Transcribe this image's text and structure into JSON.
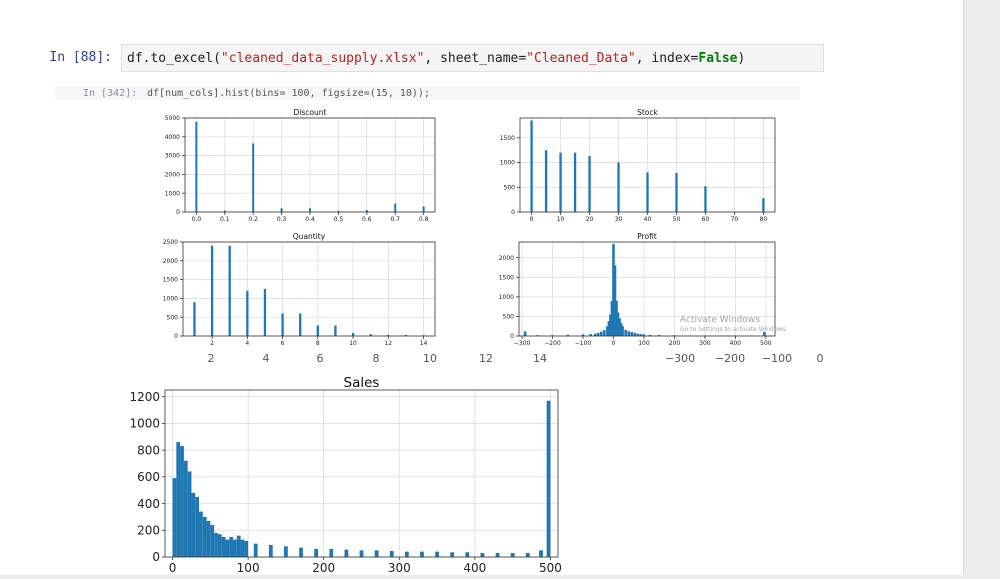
{
  "notebook": {
    "prompt": "In [88]:",
    "code_parts": {
      "p1": "df.to_excel(",
      "s1": "\"cleaned_data_supply.xlsx\"",
      "p2": ", sheet_name=",
      "s2": "\"Cleaned_Data\"",
      "p3": ", index=",
      "k1": "False",
      "p4": ")"
    },
    "embedded_prompt": "In [342]:",
    "embedded_code": "df[num_cols].hist(bins= 100, figsize=(15, 10));",
    "watermark_line1": "Activate Windows",
    "watermark_line2": "Go to Settings to activate Windows."
  },
  "bleed_ticks": [
    "2",
    "4",
    "6",
    "8",
    "10",
    "12",
    "14",
    "−300",
    "−200",
    "−100",
    "0"
  ],
  "chart_data": [
    {
      "type": "bar",
      "title": "Discount",
      "xlim": [
        -0.04,
        0.84
      ],
      "ylim": [
        0,
        5000
      ],
      "xticks": [
        0.0,
        0.1,
        0.2,
        0.3,
        0.4,
        0.5,
        0.6,
        0.7,
        0.8
      ],
      "xticklabels": [
        "0.0",
        "0.1",
        "0.2",
        "0.3",
        "0.4",
        "0.5",
        "0.6",
        "0.7",
        "0.8"
      ],
      "yticks": [
        0,
        1000,
        2000,
        3000,
        4000,
        5000
      ],
      "yticklabels": [
        "0",
        "1000",
        "2000",
        "3000",
        "4000",
        "5000"
      ],
      "x": [
        0.0,
        0.1,
        0.2,
        0.3,
        0.4,
        0.5,
        0.6,
        0.7,
        0.8
      ],
      "values": [
        4800,
        80,
        3650,
        200,
        200,
        60,
        100,
        450,
        300
      ],
      "bar_width": 0.007,
      "grid": true
    },
    {
      "type": "bar",
      "title": "Stock",
      "xlim": [
        -4,
        84
      ],
      "ylim": [
        0,
        1900
      ],
      "xticks": [
        0,
        10,
        20,
        30,
        40,
        50,
        60,
        70,
        80
      ],
      "xticklabels": [
        "0",
        "10",
        "20",
        "30",
        "40",
        "50",
        "60",
        "70",
        "80"
      ],
      "yticks": [
        0,
        500,
        1000,
        1500
      ],
      "yticklabels": [
        "0",
        "500",
        "1000",
        "1500"
      ],
      "x": [
        0,
        5,
        10,
        15,
        20,
        30,
        40,
        50,
        60,
        80
      ],
      "values": [
        1850,
        1250,
        1200,
        1200,
        1130,
        1000,
        800,
        790,
        520,
        280
      ],
      "bar_width": 0.8,
      "grid": true
    },
    {
      "type": "bar",
      "title": "Quantity",
      "xlim": [
        0.35,
        14.65
      ],
      "ylim": [
        0,
        2500
      ],
      "xticks": [
        2,
        4,
        6,
        8,
        10,
        12,
        14
      ],
      "xticklabels": [
        "2",
        "4",
        "6",
        "8",
        "10",
        "12",
        "14"
      ],
      "yticks": [
        0,
        500,
        1000,
        1500,
        2000,
        2500
      ],
      "yticklabels": [
        "0",
        "500",
        "1000",
        "1500",
        "2000",
        "2500"
      ],
      "x": [
        1,
        2,
        3,
        4,
        5,
        6,
        7,
        8,
        9,
        10,
        11,
        12,
        13,
        14
      ],
      "values": [
        900,
        2400,
        2400,
        1200,
        1250,
        600,
        600,
        280,
        280,
        80,
        50,
        30,
        30,
        20
      ],
      "bar_width": 0.13,
      "grid": true
    },
    {
      "type": "bar",
      "title": "Profit",
      "xlim": [
        -310,
        530
      ],
      "ylim": [
        0,
        2400
      ],
      "xticks": [
        -300,
        -200,
        -100,
        0,
        100,
        200,
        300,
        400,
        500
      ],
      "xticklabels": [
        "−300",
        "−200",
        "−100",
        "0",
        "100",
        "200",
        "300",
        "400",
        "500"
      ],
      "yticks": [
        0,
        500,
        1000,
        1500,
        2000
      ],
      "yticklabels": [
        "0",
        "500",
        "1000",
        "1500",
        "2000"
      ],
      "x": [
        -290,
        -250,
        -200,
        -150,
        -100,
        -75,
        -60,
        -50,
        -40,
        -30,
        -20,
        -15,
        -10,
        -5,
        0,
        5,
        10,
        15,
        20,
        25,
        30,
        40,
        50,
        60,
        70,
        80,
        90,
        100,
        120,
        150,
        200,
        250,
        300,
        350,
        400,
        450,
        495
      ],
      "values": [
        120,
        20,
        20,
        30,
        40,
        50,
        60,
        80,
        110,
        150,
        250,
        380,
        550,
        900,
        2350,
        1800,
        900,
        600,
        450,
        330,
        250,
        160,
        120,
        100,
        80,
        60,
        50,
        40,
        30,
        25,
        20,
        15,
        15,
        10,
        10,
        10,
        100
      ],
      "bar_width": 8.4,
      "grid": true
    },
    {
      "type": "bar",
      "title": "Sales",
      "xlim": [
        -10,
        510
      ],
      "ylim": [
        0,
        1250
      ],
      "xticks": [
        0,
        100,
        200,
        300,
        400,
        500
      ],
      "xticklabels": [
        "0",
        "100",
        "200",
        "300",
        "400",
        "500"
      ],
      "yticks": [
        0,
        200,
        400,
        600,
        800,
        1000,
        1200
      ],
      "yticklabels": [
        "0",
        "200",
        "400",
        "600",
        "800",
        "1000",
        "1200"
      ],
      "x": [
        2.5,
        7.5,
        12.5,
        17.5,
        22.5,
        27.5,
        32.5,
        37.5,
        42.5,
        47.5,
        52.5,
        57.5,
        62.5,
        67.5,
        72.5,
        77.5,
        82.5,
        87.5,
        92.5,
        97.5,
        110,
        130,
        150,
        170,
        190,
        210,
        230,
        250,
        270,
        290,
        310,
        330,
        350,
        370,
        390,
        410,
        430,
        450,
        470,
        487.5,
        497.5
      ],
      "values": [
        590,
        860,
        830,
        720,
        640,
        480,
        450,
        340,
        300,
        270,
        240,
        180,
        170,
        150,
        130,
        150,
        130,
        160,
        130,
        120,
        100,
        90,
        80,
        70,
        60,
        60,
        55,
        50,
        50,
        45,
        40,
        40,
        40,
        35,
        35,
        30,
        30,
        30,
        30,
        50,
        1170
      ],
      "bar_width": 5,
      "grid": true
    }
  ]
}
